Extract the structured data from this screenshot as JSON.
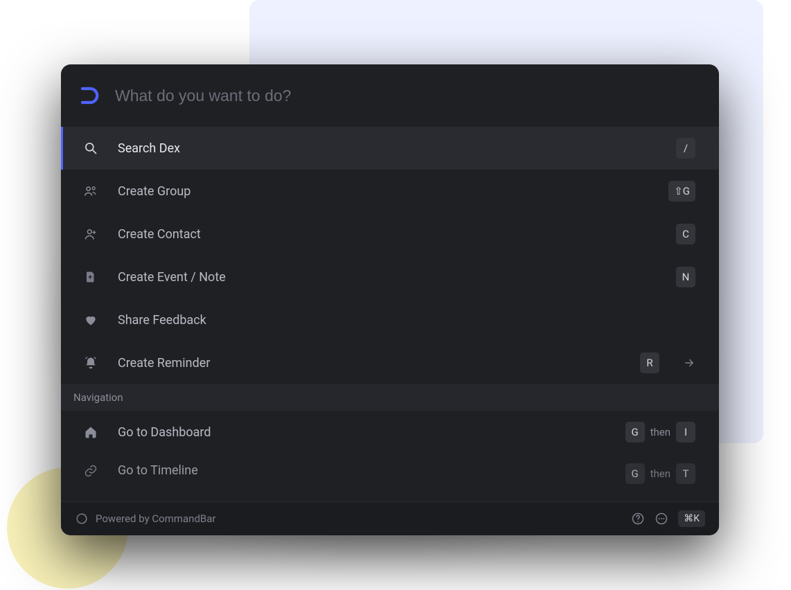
{
  "search": {
    "placeholder": "What do you want to do?"
  },
  "commands": [
    {
      "icon": "search-icon",
      "label": "Search Dex",
      "shortcut": {
        "keys": [
          "/"
        ]
      },
      "selected": true
    },
    {
      "icon": "group-icon",
      "label": "Create Group",
      "shortcut": {
        "keys": [
          "⇧G"
        ]
      },
      "selected": false
    },
    {
      "icon": "person-icon",
      "label": "Create Contact",
      "shortcut": {
        "keys": [
          "C"
        ]
      },
      "selected": false
    },
    {
      "icon": "file-icon",
      "label": "Create Event / Note",
      "shortcut": {
        "keys": [
          "N"
        ]
      },
      "selected": false
    },
    {
      "icon": "heart-icon",
      "label": "Share Feedback",
      "shortcut": null,
      "selected": false
    },
    {
      "icon": "bell-icon",
      "label": "Create Reminder",
      "shortcut": {
        "keys": [
          "R"
        ]
      },
      "selected": false,
      "arrow": true
    }
  ],
  "section": {
    "label": "Navigation"
  },
  "navigation": [
    {
      "icon": "home-icon",
      "label": "Go to Dashboard",
      "shortcut": {
        "keys": [
          "G",
          "I"
        ],
        "then": "then"
      }
    },
    {
      "icon": "link-icon",
      "label": "Go to Timeline",
      "shortcut": {
        "keys": [
          "G",
          "T"
        ],
        "then": "then"
      }
    }
  ],
  "footer": {
    "powered_by": "Powered by CommandBar",
    "shortcut": "⌘K"
  }
}
